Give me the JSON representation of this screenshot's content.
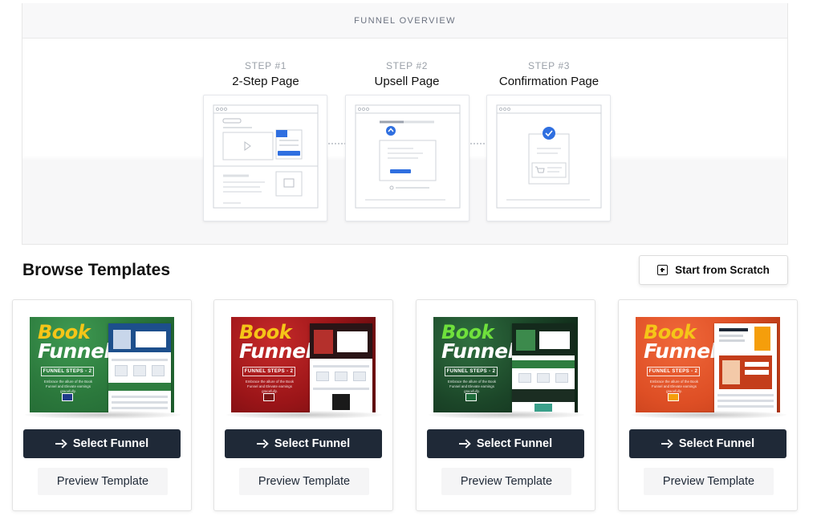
{
  "overview": {
    "header": "FUNNEL OVERVIEW",
    "steps": [
      {
        "kicker": "STEP #1",
        "title": "2-Step Page"
      },
      {
        "kicker": "STEP #2",
        "title": "Upsell Page"
      },
      {
        "kicker": "STEP #3",
        "title": "Confirmation Page"
      }
    ]
  },
  "browse": {
    "title": "Browse Templates",
    "scratch_label": "Start from Scratch"
  },
  "templates": [
    {
      "book_line1": "Book",
      "book_line2": "Funnel",
      "steps_label": "FUNNEL STEPS - 2",
      "tagline": "Embrace the allure of the Book Funnel and Elevate earnings gracefully.",
      "select_label": "Select Funnel",
      "preview_label": "Preview Template",
      "theme": "green",
      "accent": "#f5c518"
    },
    {
      "book_line1": "Book",
      "book_line2": "Funnel",
      "steps_label": "FUNNEL STEPS - 2",
      "tagline": "Embrace the allure of the Book Funnel and Elevate earnings gracefully.",
      "select_label": "Select Funnel",
      "preview_label": "Preview Template",
      "theme": "red",
      "accent": "#f5c518"
    },
    {
      "book_line1": "Book",
      "book_line2": "Funnel",
      "steps_label": "FUNNEL STEPS - 2",
      "tagline": "Embrace the allure of the Book Funnel and Elevate earnings gracefully.",
      "select_label": "Select Funnel",
      "preview_label": "Preview Template",
      "theme": "darkgreen",
      "accent": "#6fe03c"
    },
    {
      "book_line1": "Book",
      "book_line2": "Funnel",
      "steps_label": "FUNNEL STEPS - 2",
      "tagline": "Embrace the allure of the Book Funnel and Elevate earnings gracefully.",
      "select_label": "Select Funnel",
      "preview_label": "Preview Template",
      "theme": "orange",
      "accent": "#f5c518"
    }
  ],
  "colors": {
    "button_dark": "#1f2937",
    "step_accent": "#2f6fe0",
    "green": "#2e7d3f",
    "red": "#a4161a",
    "darkgreen": "#14321f",
    "orange": "#e2572a"
  }
}
